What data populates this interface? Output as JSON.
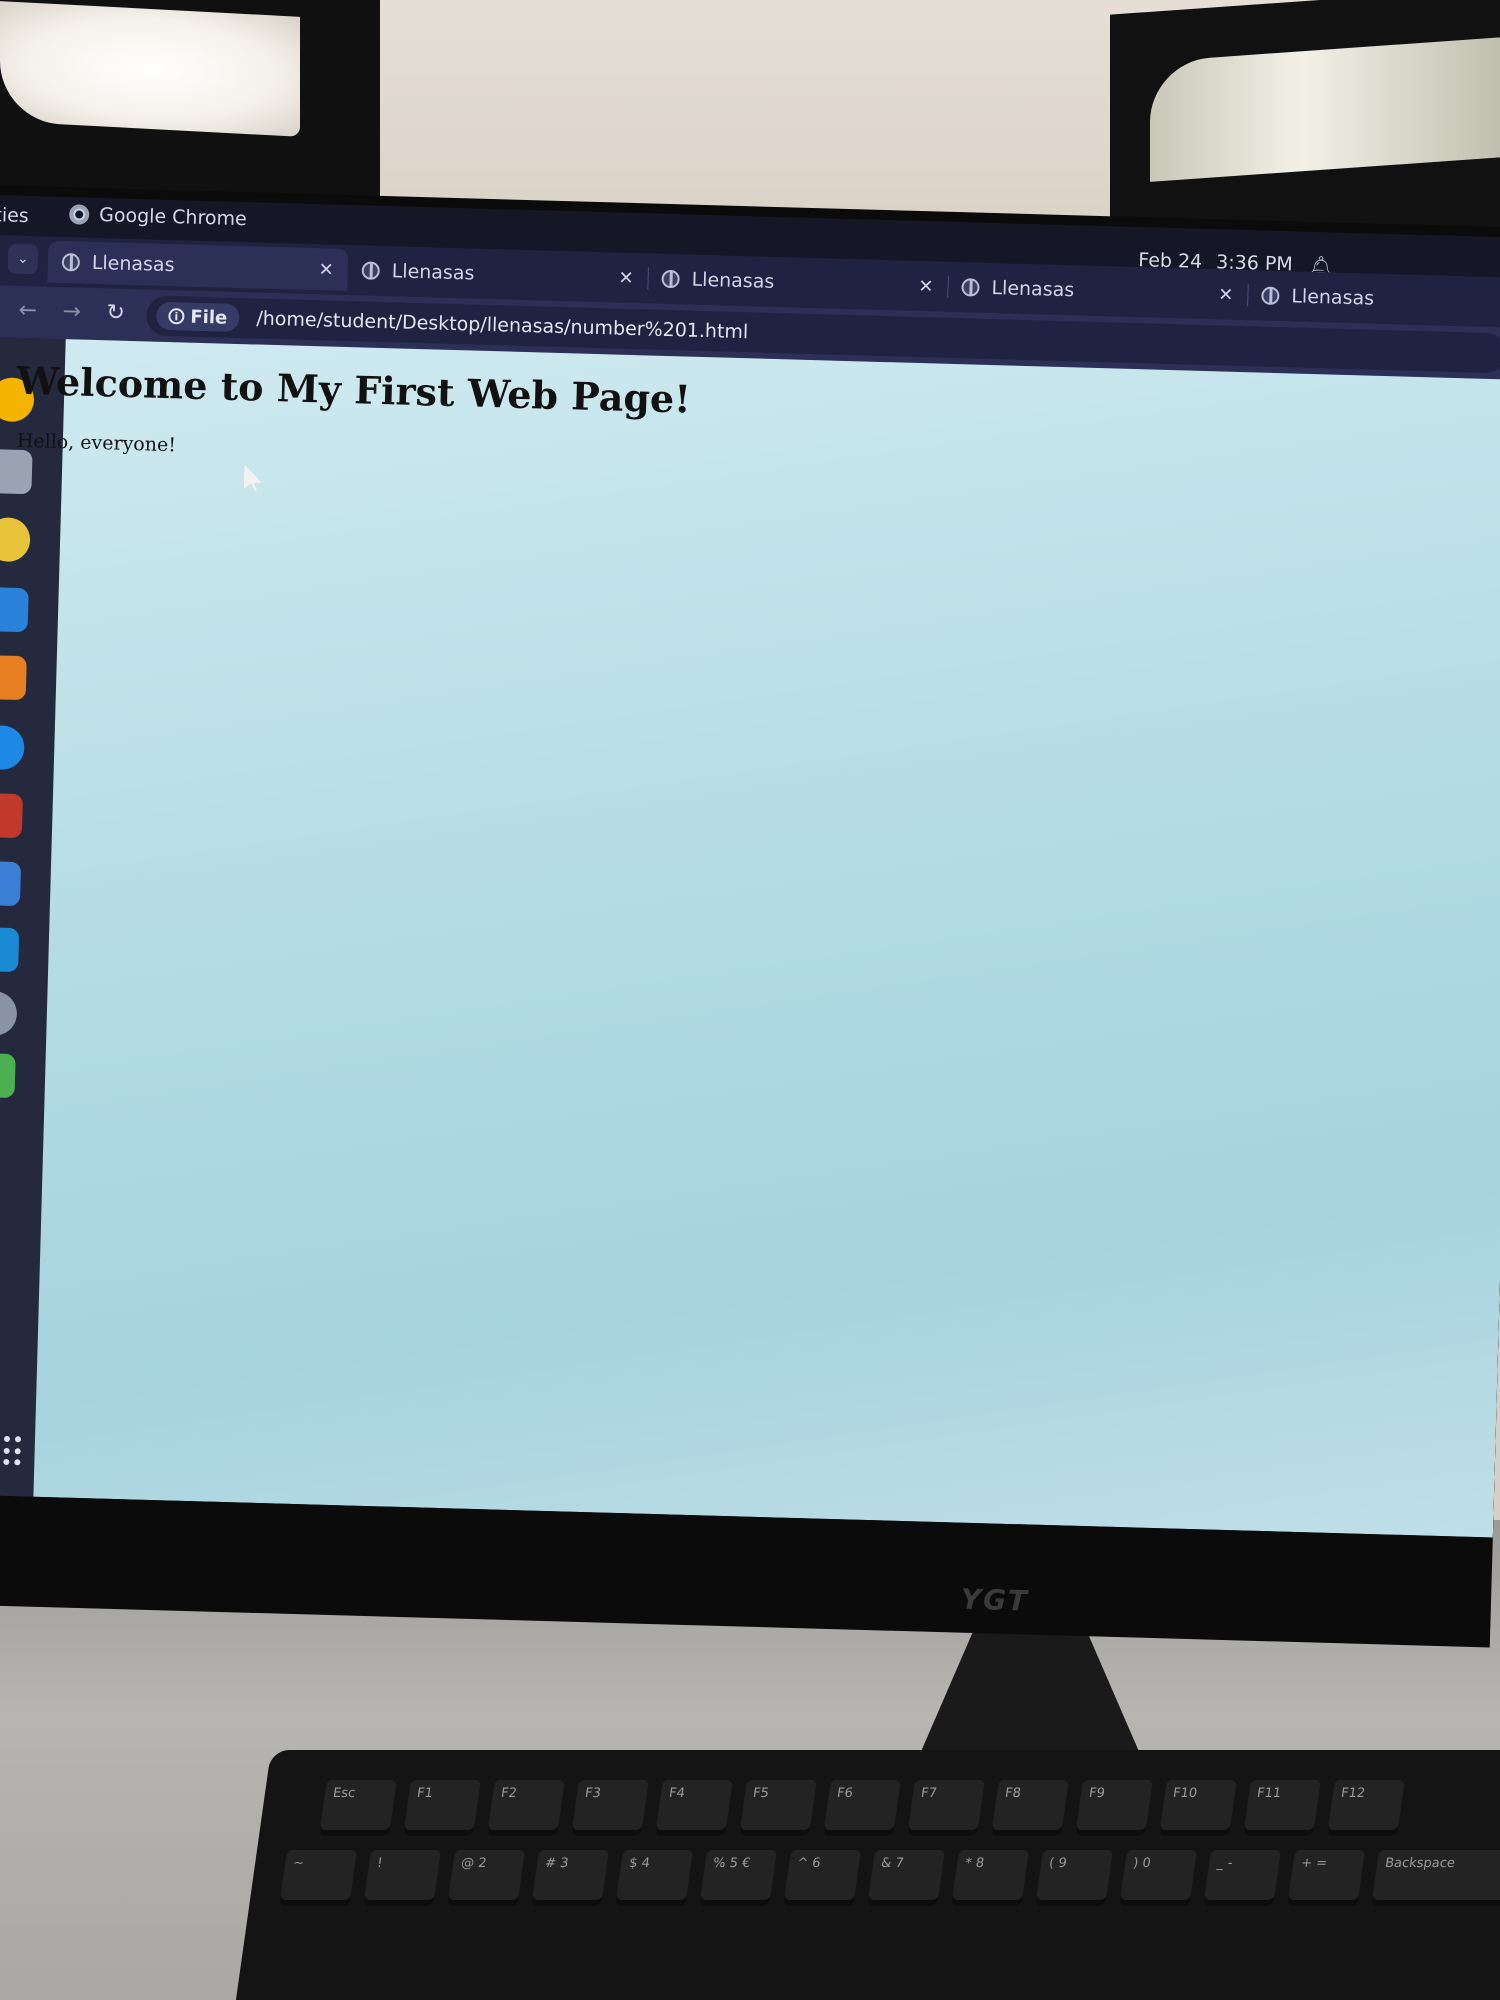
{
  "topbar": {
    "activities_label": "ities",
    "app_name": "Google Chrome",
    "date": "Feb 24",
    "time": "3:36 PM"
  },
  "tabs": [
    {
      "label": "Llenasas",
      "active": true
    },
    {
      "label": "Llenasas",
      "active": false
    },
    {
      "label": "Llenasas",
      "active": false
    },
    {
      "label": "Llenasas",
      "active": false
    },
    {
      "label": "Llenasas",
      "active": false
    }
  ],
  "toolbar": {
    "file_chip": "File",
    "url": "/home/student/Desktop/llenasas/number%201.html"
  },
  "page": {
    "heading": "Welcome to My First Web Page!",
    "paragraph": "Hello, everyone!"
  },
  "monitor": {
    "brand": "YGT"
  },
  "keyboard": {
    "row1": [
      "Esc",
      "F1",
      "F2",
      "F3",
      "F4",
      "F5",
      "F6",
      "F7",
      "F8",
      "F9",
      "F10",
      "F11",
      "F12"
    ],
    "row2": [
      "~",
      "!",
      "@ 2",
      "# 3",
      "$ 4",
      "% 5 €",
      "^ 6",
      "& 7",
      "* 8",
      "( 9",
      ") 0",
      "_ -",
      "+ =",
      "Backspace"
    ]
  },
  "colors": {
    "page_bg": "#b6dde5",
    "topbar_bg": "#151726",
    "tabstrip_bg": "#1f2240",
    "toolbar_bg": "#2c3057",
    "dock_bg": "#24293e"
  },
  "dock_icons": [
    "chrome-icon",
    "files-icon",
    "rhythmbox-icon",
    "writer-icon",
    "app-store-icon",
    "help-icon",
    "impress-icon",
    "text-editor-icon",
    "vscode-icon",
    "disc-icon",
    "trash-icon",
    "show-apps-icon"
  ]
}
